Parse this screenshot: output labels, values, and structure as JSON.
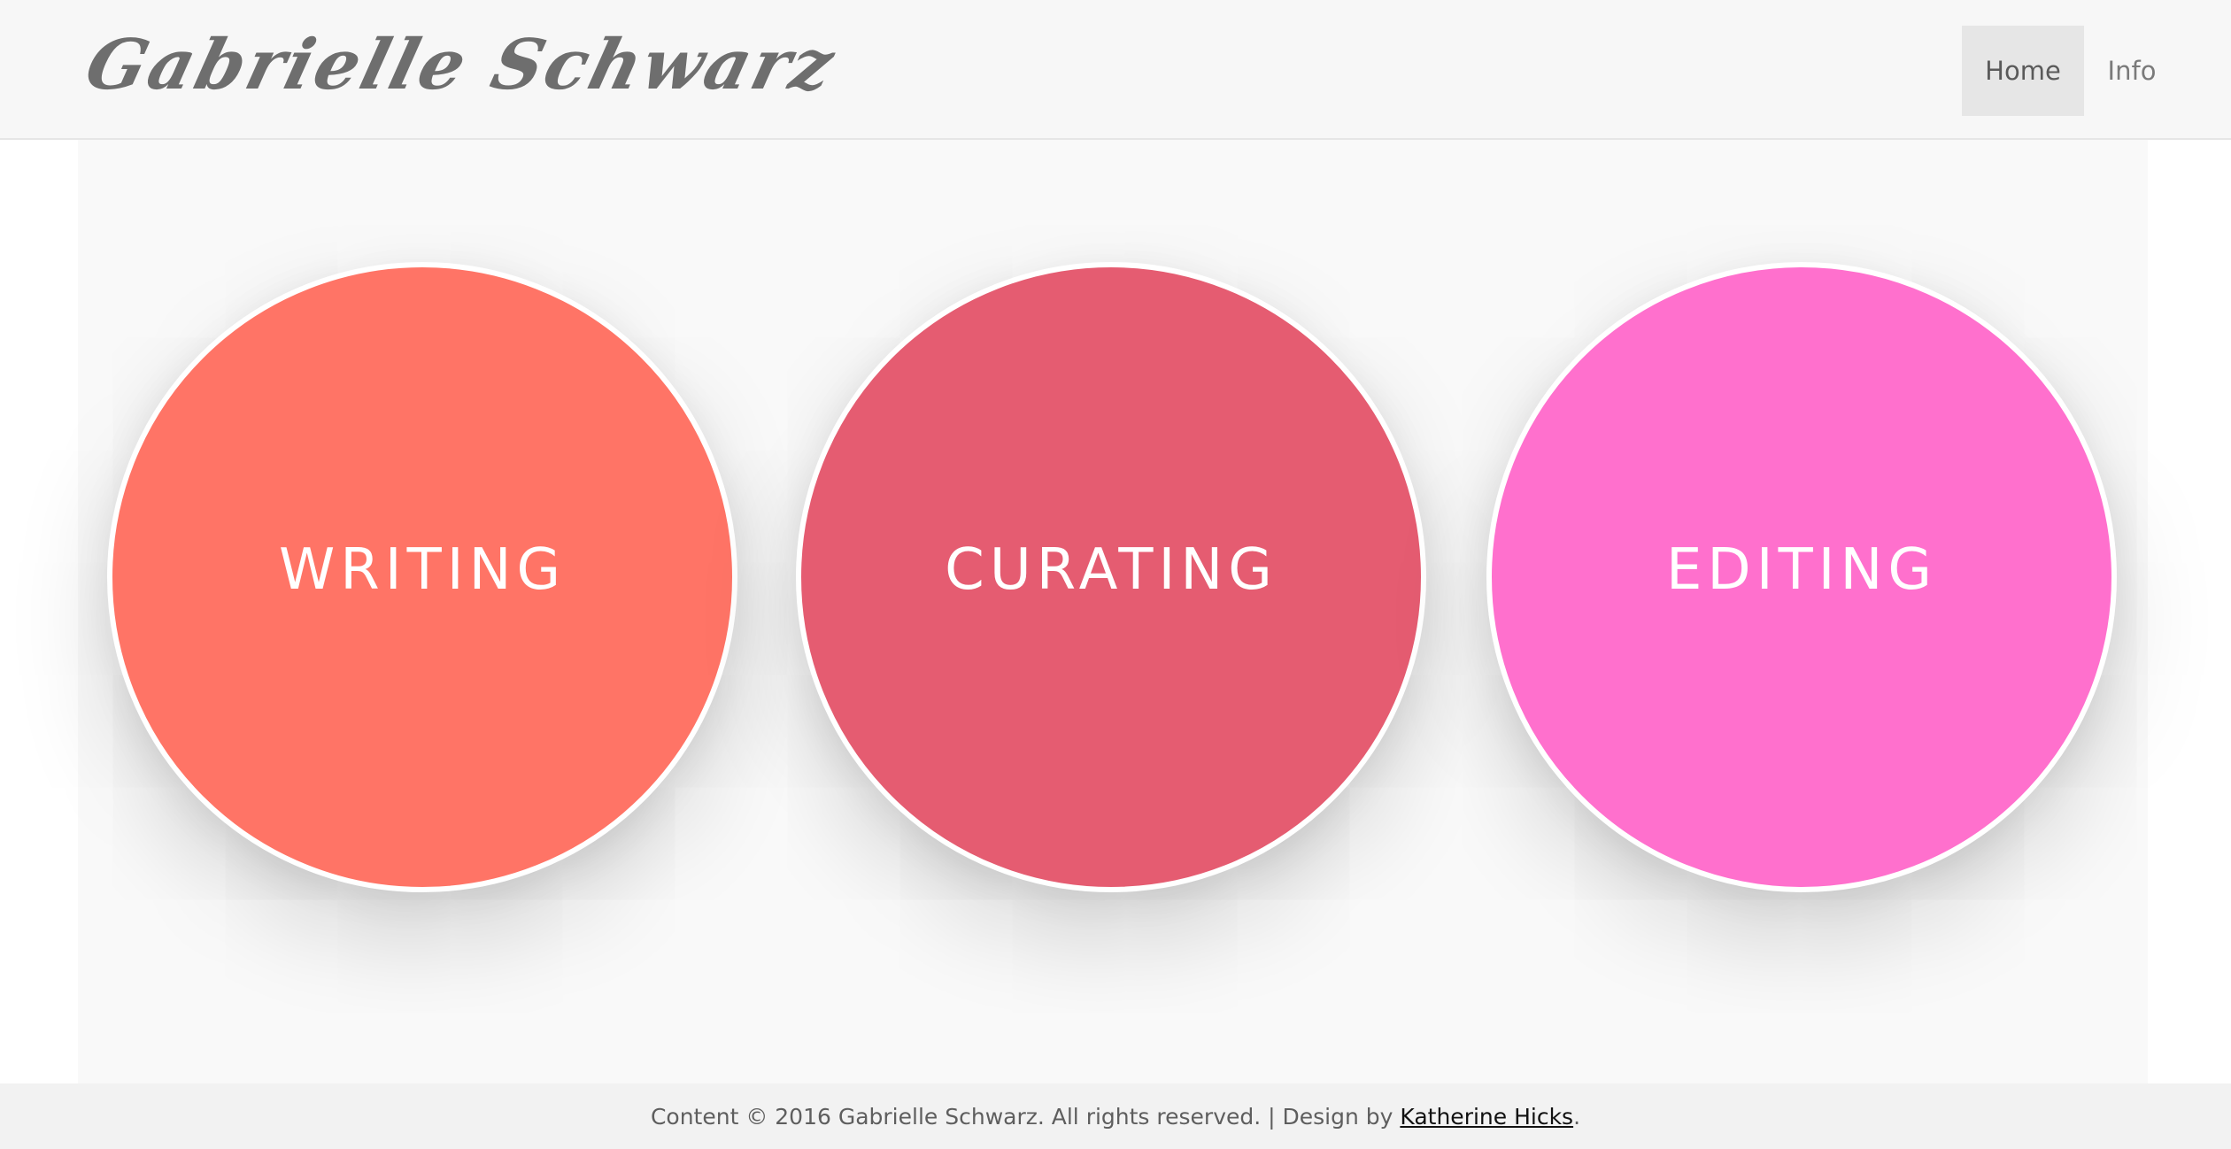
{
  "header": {
    "logo_text": "Gabrielle Schwarz",
    "nav": [
      {
        "label": "Home",
        "active": true
      },
      {
        "label": "Info",
        "active": false
      }
    ]
  },
  "circles": [
    {
      "label": "WRITING",
      "color": "#ff7466"
    },
    {
      "label": "CURATING",
      "color": "#e55c71"
    },
    {
      "label": "EDITING",
      "color": "#ff70cd"
    }
  ],
  "footer": {
    "text": "Content © 2016 Gabrielle Schwarz. All rights reserved. | Design by ",
    "link_text": "Katherine Hicks",
    "suffix": "."
  },
  "colors": {
    "header_bg": "#f7f7f7",
    "active_nav_bg": "#e6e6e6",
    "main_bg": "#f9f9f9",
    "footer_bg": "#f2f2f2",
    "logo": "#6e6e6e"
  }
}
